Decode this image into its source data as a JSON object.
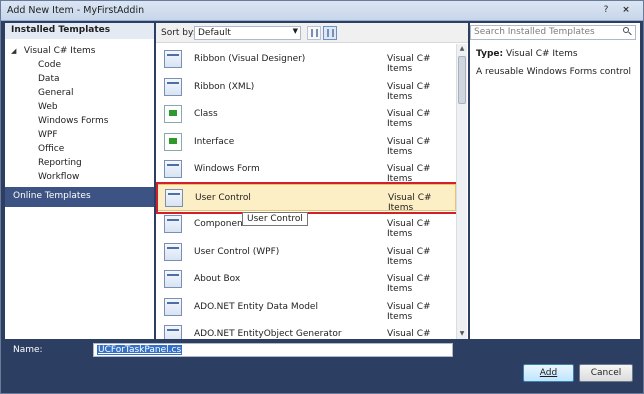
{
  "window": {
    "title": "Add New Item - MyFirstAddin",
    "help": "?",
    "close": "×"
  },
  "sidebar": {
    "header": "Installed Templates",
    "root": {
      "expander": "◢",
      "label": "Visual C# Items"
    },
    "items": [
      "Code",
      "Data",
      "General",
      "Web",
      "Windows Forms",
      "WPF",
      "Office",
      "Reporting",
      "Workflow"
    ],
    "online": "Online Templates"
  },
  "toolbar": {
    "sort_label": "Sort by:",
    "sort_value": "Default",
    "sort_arrow": "▼"
  },
  "templates": [
    {
      "name": "Ribbon (Visual Designer)",
      "type": "Visual C# Items",
      "icon": "ribbon-icon"
    },
    {
      "name": "Ribbon (XML)",
      "type": "Visual C# Items",
      "icon": "ribbon-xml-icon"
    },
    {
      "name": "Class",
      "type": "Visual C# Items",
      "icon": "class-file-icon"
    },
    {
      "name": "Interface",
      "type": "Visual C# Items",
      "icon": "interface-file-icon"
    },
    {
      "name": "Windows Form",
      "type": "Visual C# Items",
      "icon": "windows-form-icon"
    },
    {
      "name": "User Control",
      "type": "Visual C# Items",
      "icon": "user-control-icon",
      "selected": true
    },
    {
      "name": "Component",
      "type": "Visual C# Items",
      "icon": "component-icon"
    },
    {
      "name": "User Control (WPF)",
      "type": "Visual C# Items",
      "icon": "wpf-user-control-icon"
    },
    {
      "name": "About Box",
      "type": "Visual C# Items",
      "icon": "about-box-icon"
    },
    {
      "name": "ADO.NET Entity Data Model",
      "type": "Visual C# Items",
      "icon": "entity-model-icon"
    },
    {
      "name": "ADO.NET EntityObject Generator",
      "type": "Visual C# Items",
      "icon": "entity-generator-icon"
    }
  ],
  "tooltip": "User Control",
  "scroll": {
    "up": "▲",
    "down": "▼"
  },
  "details": {
    "search_placeholder": "Search Installed Templates",
    "type_label": "Type:",
    "type_value": "Visual C# Items",
    "description": "A reusable Windows Forms control"
  },
  "name_field": {
    "label": "Name:",
    "value": "UCForTaskPanel.cs"
  },
  "buttons": {
    "add": "Add",
    "cancel": "Cancel"
  },
  "colors": {
    "accent_highlight": "#d1202a",
    "selected_row": "#fdefc5",
    "online_bg": "#3c5383"
  }
}
